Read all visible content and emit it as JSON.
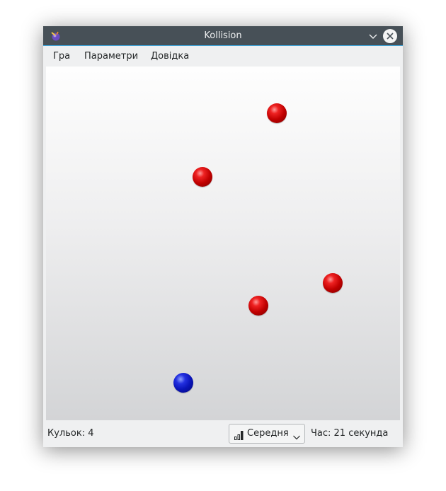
{
  "window": {
    "title": "Kollision"
  },
  "menu": {
    "items": [
      {
        "label": "Гра"
      },
      {
        "label": "Параметри"
      },
      {
        "label": "Довідка"
      }
    ]
  },
  "icons": {
    "app": "kollision-app-icon",
    "minimize": "chevron-down-icon",
    "close": "close-icon",
    "difficulty": "bar-chart-icon",
    "dropdown": "chevron-down-icon"
  },
  "colors": {
    "titlebar": "#475057",
    "accent": "#3daee9",
    "red_ball": "#d00000",
    "blue_ball": "#1020c8"
  },
  "game": {
    "balls": [
      {
        "color": "red"
      },
      {
        "color": "red"
      },
      {
        "color": "red"
      },
      {
        "color": "red"
      },
      {
        "color": "blue"
      }
    ]
  },
  "status": {
    "ball_count": "Кульок: 4",
    "difficulty": "Середня",
    "time": "Час: 21 секунда"
  }
}
